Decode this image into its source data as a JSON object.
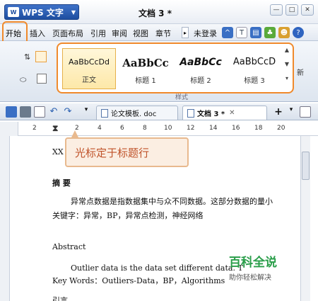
{
  "titlebar": {
    "app_button": "WPS 文字",
    "logo_text": "W",
    "doc_title": "文档 3 *",
    "window_controls": [
      "—",
      "□",
      "✕"
    ]
  },
  "menu": {
    "items": [
      "开始",
      "插入",
      "页面布局",
      "引用",
      "审阅",
      "视图",
      "章节"
    ],
    "login": "未登录",
    "right_icons": [
      "skin-icon",
      "shirt-icon",
      "template-icon",
      "shop-icon",
      "user-icon",
      "help-icon"
    ]
  },
  "ribbon": {
    "styles": [
      {
        "sample": "AaBbCcDd",
        "label": "正文"
      },
      {
        "sample": "AaBbCc",
        "label": "标题 1"
      },
      {
        "sample": "AaBbCc",
        "label": "标题 2"
      },
      {
        "sample": "AaBbCcD",
        "label": "标题 3"
      }
    ],
    "group_label": "样式",
    "right_label": "新"
  },
  "tabs": {
    "doc_tabs": [
      {
        "name": "论文模板. doc",
        "close": "✕"
      },
      {
        "name": "文档 3 *",
        "close": "✕"
      }
    ],
    "add": "+"
  },
  "ruler": {
    "numbers": [
      "2",
      "2",
      "4",
      "6",
      "8",
      "10",
      "12",
      "14",
      "16",
      "18",
      "20"
    ]
  },
  "document": {
    "xx": "XX",
    "abstract_heading": "摘 要",
    "cn_body": "异常点数据是指数据集中与众不同数据。这部分数据的量小",
    "cn_keywords": "关键字：异常，BP，异常点检测，神经网络",
    "en_heading": "Abstract",
    "en_body": "Outlier data is the data set different data. T",
    "en_keywords": "Key Words：Outliers-Data，BP，Algorithms",
    "intro_heading": "引言"
  },
  "callout": {
    "text": "光标定于标题行"
  },
  "watermark": {
    "title": "百科全说",
    "subtitle": "助你轻松解决"
  }
}
